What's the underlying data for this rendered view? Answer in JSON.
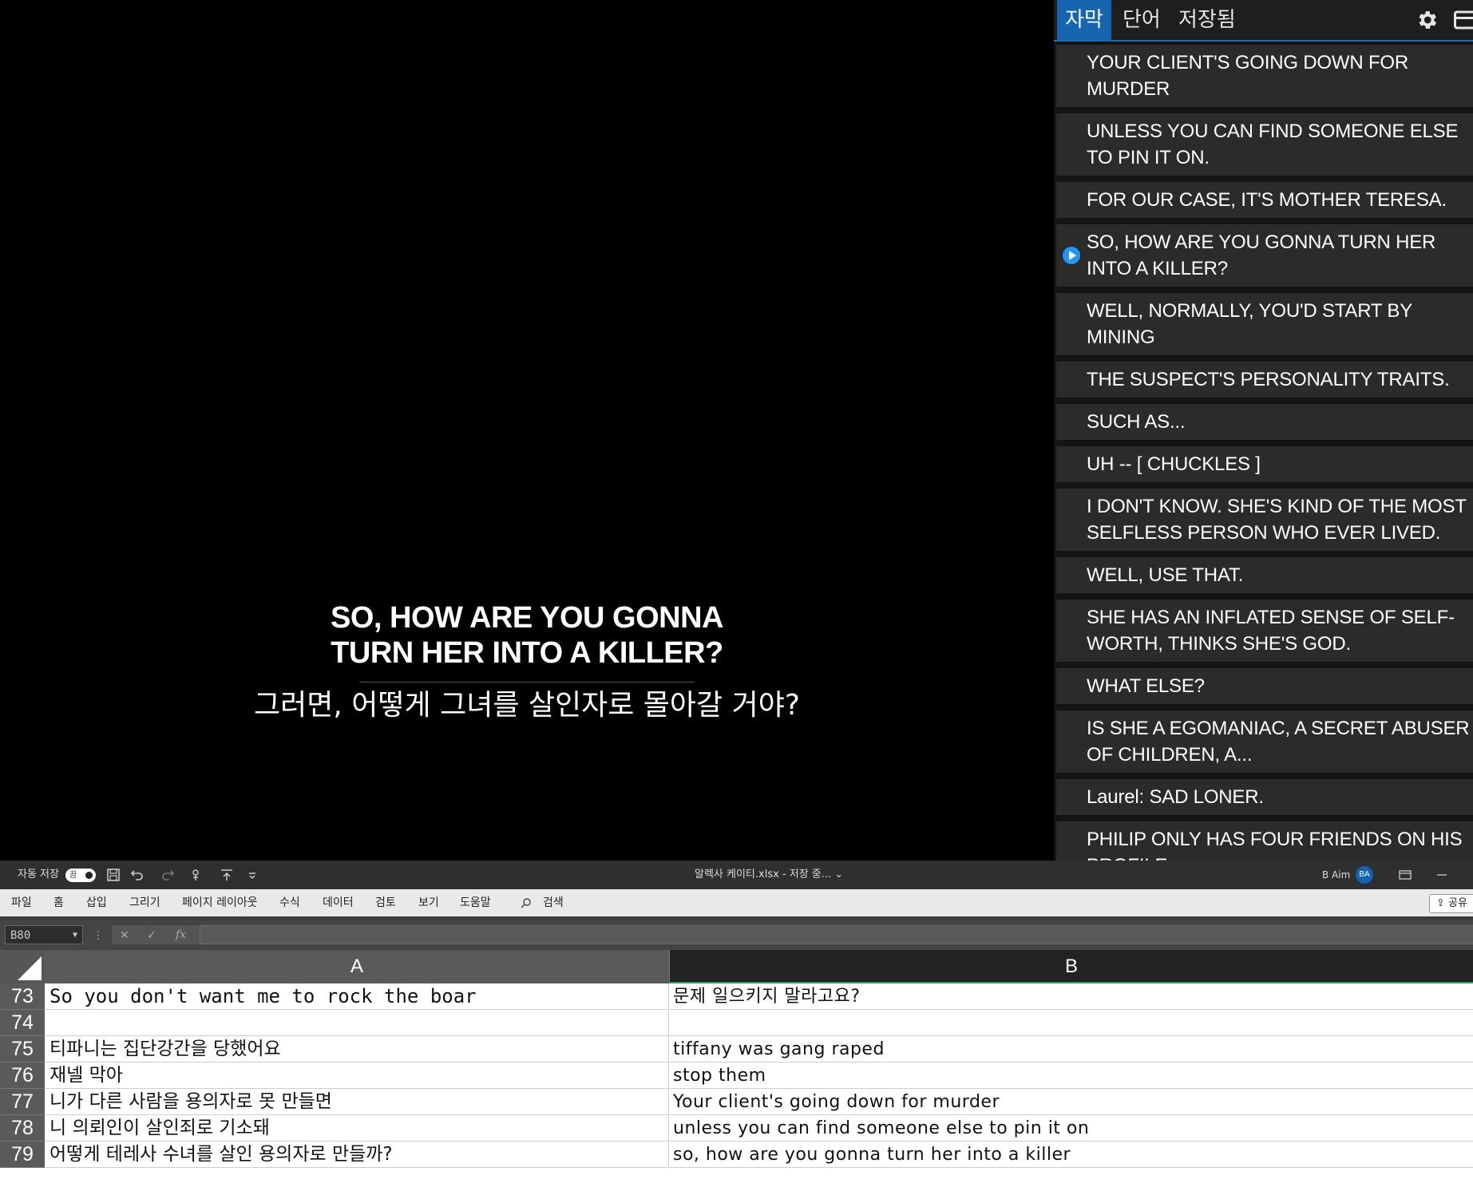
{
  "video": {
    "subtitle_en_line1": "SO, HOW ARE YOU GONNA",
    "subtitle_en_line2": "TURN HER INTO A KILLER?",
    "subtitle_ko": "그러면, 어떻게 그녀를 살인자로 몰아갈 거야?"
  },
  "panel": {
    "tabs": [
      {
        "label": "자막",
        "active": true
      },
      {
        "label": "단어",
        "active": false
      },
      {
        "label": "저장됨",
        "active": false
      }
    ],
    "icons": [
      "gear-icon",
      "window-icon"
    ],
    "accent_color": "#1565b0",
    "items": [
      {
        "text": "YOUR CLIENT'S GOING DOWN FOR\nMURDER",
        "playing": false
      },
      {
        "text": "UNLESS YOU CAN FIND SOMEONE ELSE\nTO PIN IT ON.",
        "playing": false
      },
      {
        "text": "FOR OUR CASE, IT'S MOTHER TERESA.",
        "playing": false
      },
      {
        "text": "SO, HOW ARE YOU GONNA TURN HER\nINTO A KILLER?",
        "playing": true
      },
      {
        "text": "WELL, NORMALLY, YOU'D START BY\nMINING",
        "playing": false
      },
      {
        "text": "THE SUSPECT'S PERSONALITY TRAITS.",
        "playing": false
      },
      {
        "text": "SUCH AS...",
        "playing": false
      },
      {
        "text": "UH -- [ CHUCKLES ]",
        "playing": false
      },
      {
        "text": "I DON'T KNOW. SHE'S KIND OF THE MOST\nSELFLESS PERSON WHO EVER LIVED.",
        "playing": false
      },
      {
        "text": "WELL, USE THAT.",
        "playing": false
      },
      {
        "text": "SHE HAS AN INFLATED SENSE OF SELF-\nWORTH, THINKS SHE'S GOD.",
        "playing": false
      },
      {
        "text": "WHAT ELSE?",
        "playing": false
      },
      {
        "text": "IS SHE A EGOMANIAC, A SECRET ABUSER\nOF CHILDREN, A...",
        "playing": false
      },
      {
        "text": "Laurel: SAD LONER.",
        "playing": false
      },
      {
        "text": "PHILIP ONLY HAS FOUR FRIENDS ON HIS\nPROFILE,",
        "playing": false
      }
    ]
  },
  "excel": {
    "autosave_label": "자동 저장",
    "autosave_state": "끔",
    "file_title": "알렉사 케이티.xlsx - 저장 중... ⌄",
    "user_name": "B Aim",
    "user_initials": "BA",
    "menu": [
      "파일",
      "홈",
      "삽입",
      "그리기",
      "페이지 레이아웃",
      "수식",
      "데이터",
      "검토",
      "보기",
      "도움말"
    ],
    "search_label": "검색",
    "share_label": "공유",
    "name_box": "B80",
    "fx_symbols": {
      "cancel": "✕",
      "enter": "✓",
      "fx": "fx"
    },
    "columns": [
      "A",
      "B"
    ],
    "rows": [
      {
        "num": "73",
        "a": "So you don't want me to rock the boar",
        "b": "문제 일으키지 말라고요?"
      },
      {
        "num": "74",
        "a": "",
        "b": ""
      },
      {
        "num": "75",
        "a": "티파니는 집단강간을 당했어요",
        "b": "tiffany was gang raped"
      },
      {
        "num": "76",
        "a": "재넬 막아",
        "b": "stop them"
      },
      {
        "num": "77",
        "a": "니가 다른 사람을 용의자로 못 만들면",
        "b": "Your client's going down for murder"
      },
      {
        "num": "78",
        "a": "니 의뢰인이 살인죄로 기소돼",
        "b": "unless you can find someone else to pin it on"
      },
      {
        "num": "79",
        "a": "어떻게 테레사 수녀를 살인 용의자로 만들까?",
        "b": "so, how are you gonna turn her into a killer"
      }
    ]
  }
}
